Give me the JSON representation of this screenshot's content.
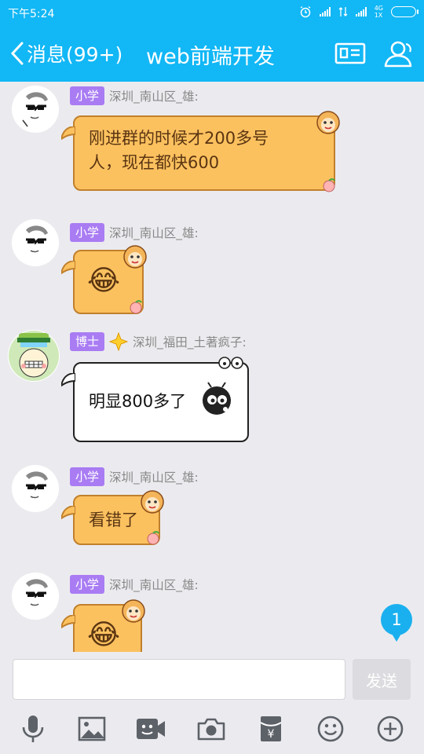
{
  "status_bar": {
    "time": "下午5:24",
    "network_label": "4G",
    "network_sub": "1X"
  },
  "header": {
    "back_label": "消息(99+)",
    "title": "web前端开发",
    "icons": [
      "profile-card-icon",
      "group-members-icon"
    ]
  },
  "messages": [
    {
      "badge": "小学",
      "nickname": "深圳_南山区_雄:",
      "text_lines": [
        "刚进群的时候才200多号",
        "人，现在都快600"
      ],
      "bubble_style": "orange-monkey"
    },
    {
      "badge": "小学",
      "nickname": "深圳_南山区_雄:",
      "emoji": "😂",
      "bubble_style": "orange-monkey"
    },
    {
      "badge": "博士",
      "nickname": "深圳_福田_土著疯子:",
      "text": "明显800多了",
      "bubble_style": "white-bug"
    },
    {
      "badge": "小学",
      "nickname": "深圳_南山区_雄:",
      "text": "看错了",
      "bubble_style": "orange-monkey"
    },
    {
      "badge": "小学",
      "nickname": "深圳_南山区_雄:",
      "emoji": "😂",
      "bubble_style": "orange-monkey"
    }
  ],
  "new_message_count": "1",
  "input": {
    "value": "",
    "send_label": "发送"
  },
  "toolbar": {
    "icons": [
      "microphone-icon",
      "image-icon",
      "video-icon",
      "camera-icon",
      "red-packet-icon",
      "emoji-icon",
      "plus-icon"
    ]
  },
  "colors": {
    "header_bg": "#12b7f5",
    "badge_purple": "#a97cf3",
    "bubble_orange": "#fcc15f",
    "bubble_border": "#c1802c",
    "chat_bg": "#ebebef"
  }
}
